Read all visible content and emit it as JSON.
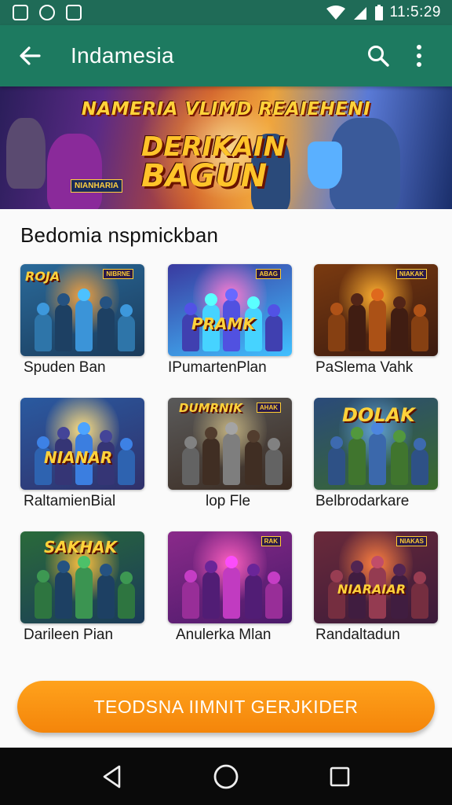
{
  "status_bar": {
    "time": "11:5:29"
  },
  "app_bar": {
    "title": "Indamesia",
    "icons": [
      "back-arrow-icon",
      "search-icon",
      "more-vert-icon"
    ]
  },
  "hero": {
    "title": "NAMERIA VLIMD REAIEHENI",
    "logo_line1": "DERIKAIN",
    "logo_line2": "BAGUN",
    "tag": "NIANHARIA"
  },
  "section": {
    "title": "Bedomia nspmickban"
  },
  "cards": [
    {
      "label": "Spuden Ban",
      "logo": "ROJA",
      "badge": "NIBRNE",
      "colors": [
        "#2a6a9a",
        "#f0a040",
        "#1a3a5a"
      ]
    },
    {
      "label": "IPumartenPlan",
      "logo": "PRAMK",
      "badge": "ABAG",
      "colors": [
        "#3a3aa0",
        "#ff7ad0",
        "#40c0ff"
      ]
    },
    {
      "label": "PaSlema Vahk",
      "logo": "",
      "badge": "NIAKAK",
      "colors": [
        "#7a3a10",
        "#ffb030",
        "#3a1a10"
      ]
    },
    {
      "label": "RaltamienBial",
      "logo": "NIANAR",
      "badge": "",
      "colors": [
        "#2a5aa0",
        "#ffe080",
        "#30306a"
      ]
    },
    {
      "label": "lop Fle",
      "logo": "DUMRNIK",
      "badge": "AHAK",
      "colors": [
        "#5a5a5a",
        "#c0b080",
        "#3a2a20"
      ]
    },
    {
      "label": "Belbrodarkare",
      "logo": "DOLAK",
      "badge": "",
      "colors": [
        "#2a4a7a",
        "#60a0d0",
        "#3a6a2a"
      ]
    },
    {
      "label": "Darileen Pian",
      "logo": "SAKHAK",
      "badge": "",
      "colors": [
        "#2a6a3a",
        "#ffc040",
        "#1a3a5a"
      ]
    },
    {
      "label": "Anulerka Mlan",
      "logo": "",
      "badge": "RAK",
      "colors": [
        "#8a2a8a",
        "#ff60c0",
        "#4a1a6a"
      ]
    },
    {
      "label": "Randaltadun",
      "logo": "NIARAIAR",
      "badge": "NIAKAS",
      "colors": [
        "#6a2a3a",
        "#ff8040",
        "#3a1a3a"
      ]
    }
  ],
  "cta": {
    "label": "TEODSNA IIMNIT GERJKIDER",
    "color": "#f7920f"
  },
  "nav_bar": {
    "icons": [
      "back-triangle-icon",
      "home-circle-icon",
      "recents-square-icon"
    ]
  },
  "colors": {
    "status_bar": "#1f6b57",
    "app_bar": "#1d7a60",
    "accent": "#f7920f"
  }
}
